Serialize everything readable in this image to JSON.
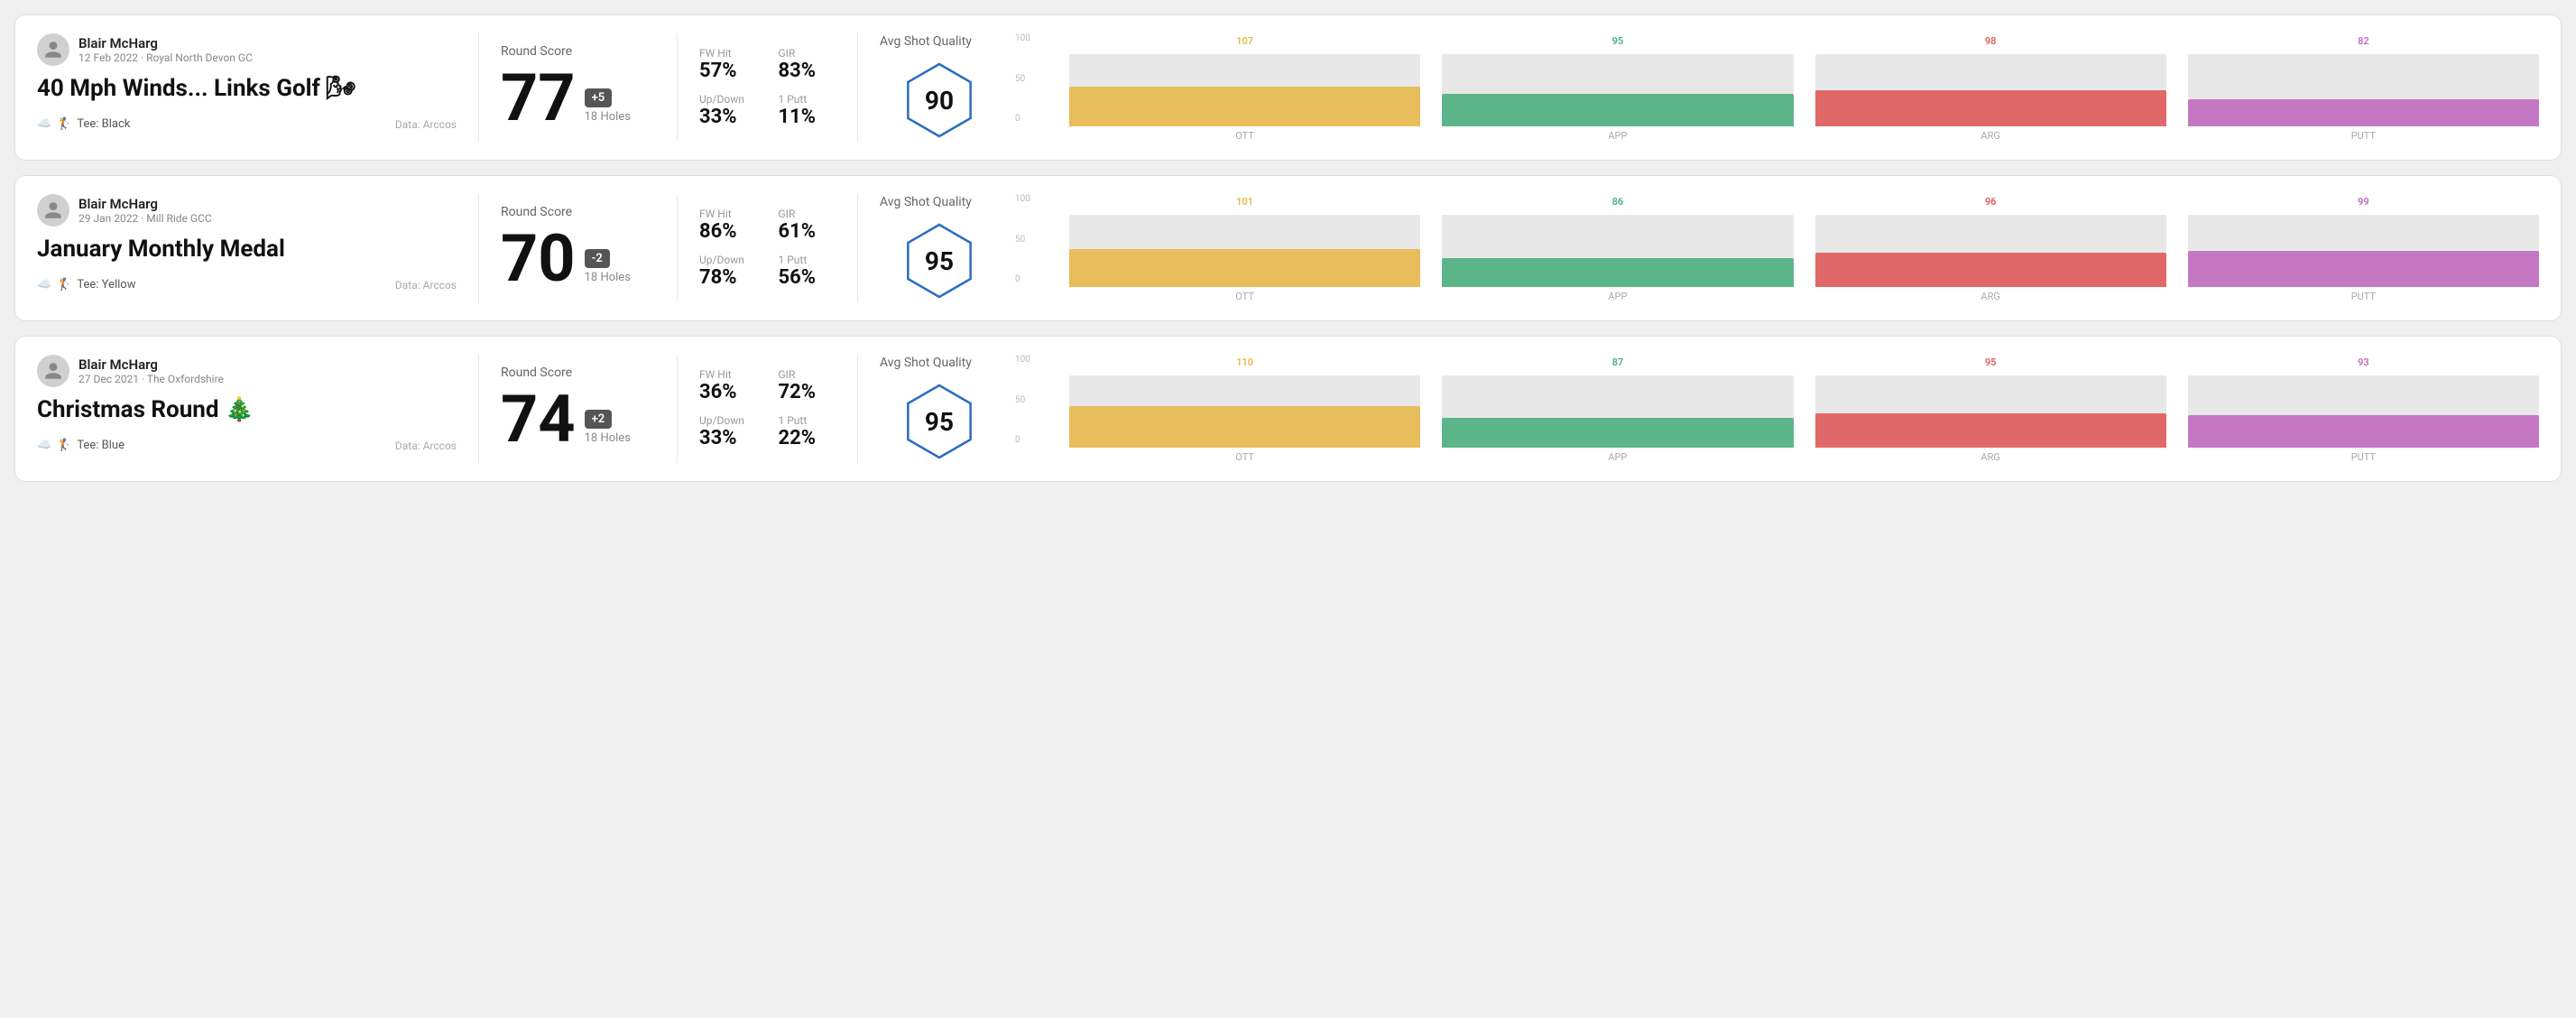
{
  "rounds": [
    {
      "id": "round1",
      "user": {
        "name": "Blair McHarg",
        "meta": "12 Feb 2022 · Royal North Devon GC"
      },
      "title": "40 Mph Winds... Links Golf 🌬",
      "tee": "Black",
      "data_source": "Data: Arccos",
      "score": "77",
      "score_diff": "+5",
      "holes": "18 Holes",
      "stats": {
        "fw_hit_label": "FW Hit",
        "fw_hit_value": "57%",
        "gir_label": "GIR",
        "gir_value": "83%",
        "updown_label": "Up/Down",
        "updown_value": "33%",
        "oneputt_label": "1 Putt",
        "oneputt_value": "11%"
      },
      "avg_shot_quality": {
        "label": "Avg Shot Quality",
        "value": "90"
      },
      "chart": {
        "bars": [
          {
            "label": "OTT",
            "top_value": "107",
            "top_color": "#e8b84b",
            "height_pct": 55
          },
          {
            "label": "APP",
            "top_value": "95",
            "top_color": "#4caf7d",
            "height_pct": 45
          },
          {
            "label": "ARG",
            "top_value": "98",
            "top_color": "#e05a5a",
            "height_pct": 50
          },
          {
            "label": "PUTT",
            "top_value": "82",
            "top_color": "#c06cc0",
            "height_pct": 38
          }
        ],
        "y_labels": [
          "100",
          "50",
          "0"
        ]
      }
    },
    {
      "id": "round2",
      "user": {
        "name": "Blair McHarg",
        "meta": "29 Jan 2022 · Mill Ride GCC"
      },
      "title": "January Monthly Medal",
      "tee": "Yellow",
      "data_source": "Data: Arccos",
      "score": "70",
      "score_diff": "-2",
      "holes": "18 Holes",
      "stats": {
        "fw_hit_label": "FW Hit",
        "fw_hit_value": "86%",
        "gir_label": "GIR",
        "gir_value": "61%",
        "updown_label": "Up/Down",
        "updown_value": "78%",
        "oneputt_label": "1 Putt",
        "oneputt_value": "56%"
      },
      "avg_shot_quality": {
        "label": "Avg Shot Quality",
        "value": "95"
      },
      "chart": {
        "bars": [
          {
            "label": "OTT",
            "top_value": "101",
            "top_color": "#e8b84b",
            "height_pct": 52
          },
          {
            "label": "APP",
            "top_value": "86",
            "top_color": "#4caf7d",
            "height_pct": 40
          },
          {
            "label": "ARG",
            "top_value": "96",
            "top_color": "#e05a5a",
            "height_pct": 48
          },
          {
            "label": "PUTT",
            "top_value": "99",
            "top_color": "#c06cc0",
            "height_pct": 50
          }
        ],
        "y_labels": [
          "100",
          "50",
          "0"
        ]
      }
    },
    {
      "id": "round3",
      "user": {
        "name": "Blair McHarg",
        "meta": "27 Dec 2021 · The Oxfordshire"
      },
      "title": "Christmas Round 🎄",
      "tee": "Blue",
      "data_source": "Data: Arccos",
      "score": "74",
      "score_diff": "+2",
      "holes": "18 Holes",
      "stats": {
        "fw_hit_label": "FW Hit",
        "fw_hit_value": "36%",
        "gir_label": "GIR",
        "gir_value": "72%",
        "updown_label": "Up/Down",
        "updown_value": "33%",
        "oneputt_label": "1 Putt",
        "oneputt_value": "22%"
      },
      "avg_shot_quality": {
        "label": "Avg Shot Quality",
        "value": "95"
      },
      "chart": {
        "bars": [
          {
            "label": "OTT",
            "top_value": "110",
            "top_color": "#e8b84b",
            "height_pct": 58
          },
          {
            "label": "APP",
            "top_value": "87",
            "top_color": "#4caf7d",
            "height_pct": 41
          },
          {
            "label": "ARG",
            "top_value": "95",
            "top_color": "#e05a5a",
            "height_pct": 47
          },
          {
            "label": "PUTT",
            "top_value": "93",
            "top_color": "#c06cc0",
            "height_pct": 45
          }
        ],
        "y_labels": [
          "100",
          "50",
          "0"
        ]
      }
    }
  ],
  "labels": {
    "round_score": "Round Score",
    "avg_shot_quality": "Avg Shot Quality",
    "fw_hit": "FW Hit",
    "gir": "GIR",
    "up_down": "Up/Down",
    "one_putt": "1 Putt",
    "data_arccos": "Data: Arccos",
    "tee_prefix": "Tee: "
  }
}
